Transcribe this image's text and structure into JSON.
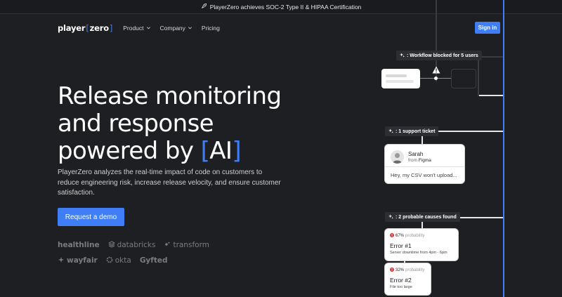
{
  "banner": {
    "text": "PlayerZero achieves SOC-2 Type II & HIPAA Certification",
    "icon": "rocket-icon"
  },
  "nav": {
    "logo_left": "player",
    "logo_right": "zero",
    "items": [
      {
        "label": "Product",
        "dropdown": true
      },
      {
        "label": "Company",
        "dropdown": true
      },
      {
        "label": "Pricing",
        "dropdown": false
      }
    ],
    "signin": "Sign in"
  },
  "hero": {
    "line1": "Release monitoring",
    "line2": "and response",
    "line3_prefix": "powered by ",
    "ai_open": "[",
    "ai_text": "AI",
    "ai_close": "]",
    "subtitle": "PlayerZero analyzes the real-time impact of code on customers to reduce engineering risk, increase release velocity, and ensure customer satisfaction.",
    "cta": "Request a demo"
  },
  "logos": {
    "row1": [
      "healthline",
      "databricks",
      "transform"
    ],
    "row2": [
      "wayfair",
      "okta",
      "Gyfted"
    ]
  },
  "flow": {
    "tag1": ": Workflow blocked for 5 users",
    "tag2": ": 1 support ticket",
    "tag3": ": 2 probable causes found",
    "ticket": {
      "name": "Sarah",
      "from_prefix": "from ",
      "from_org": "Figma",
      "message": "Hey, my CSV won't upload..."
    },
    "causes": [
      {
        "percent": "67%",
        "prob_label": "probability",
        "title": "Error #1",
        "desc": "Server downtime from 4pm - 6pm"
      },
      {
        "percent": "32%",
        "prob_label": "probability",
        "title": "Error #2",
        "desc": "File too large"
      }
    ]
  },
  "colors": {
    "accent": "#3f7ef6",
    "background": "#1e1f22",
    "error": "#d13b3b"
  }
}
